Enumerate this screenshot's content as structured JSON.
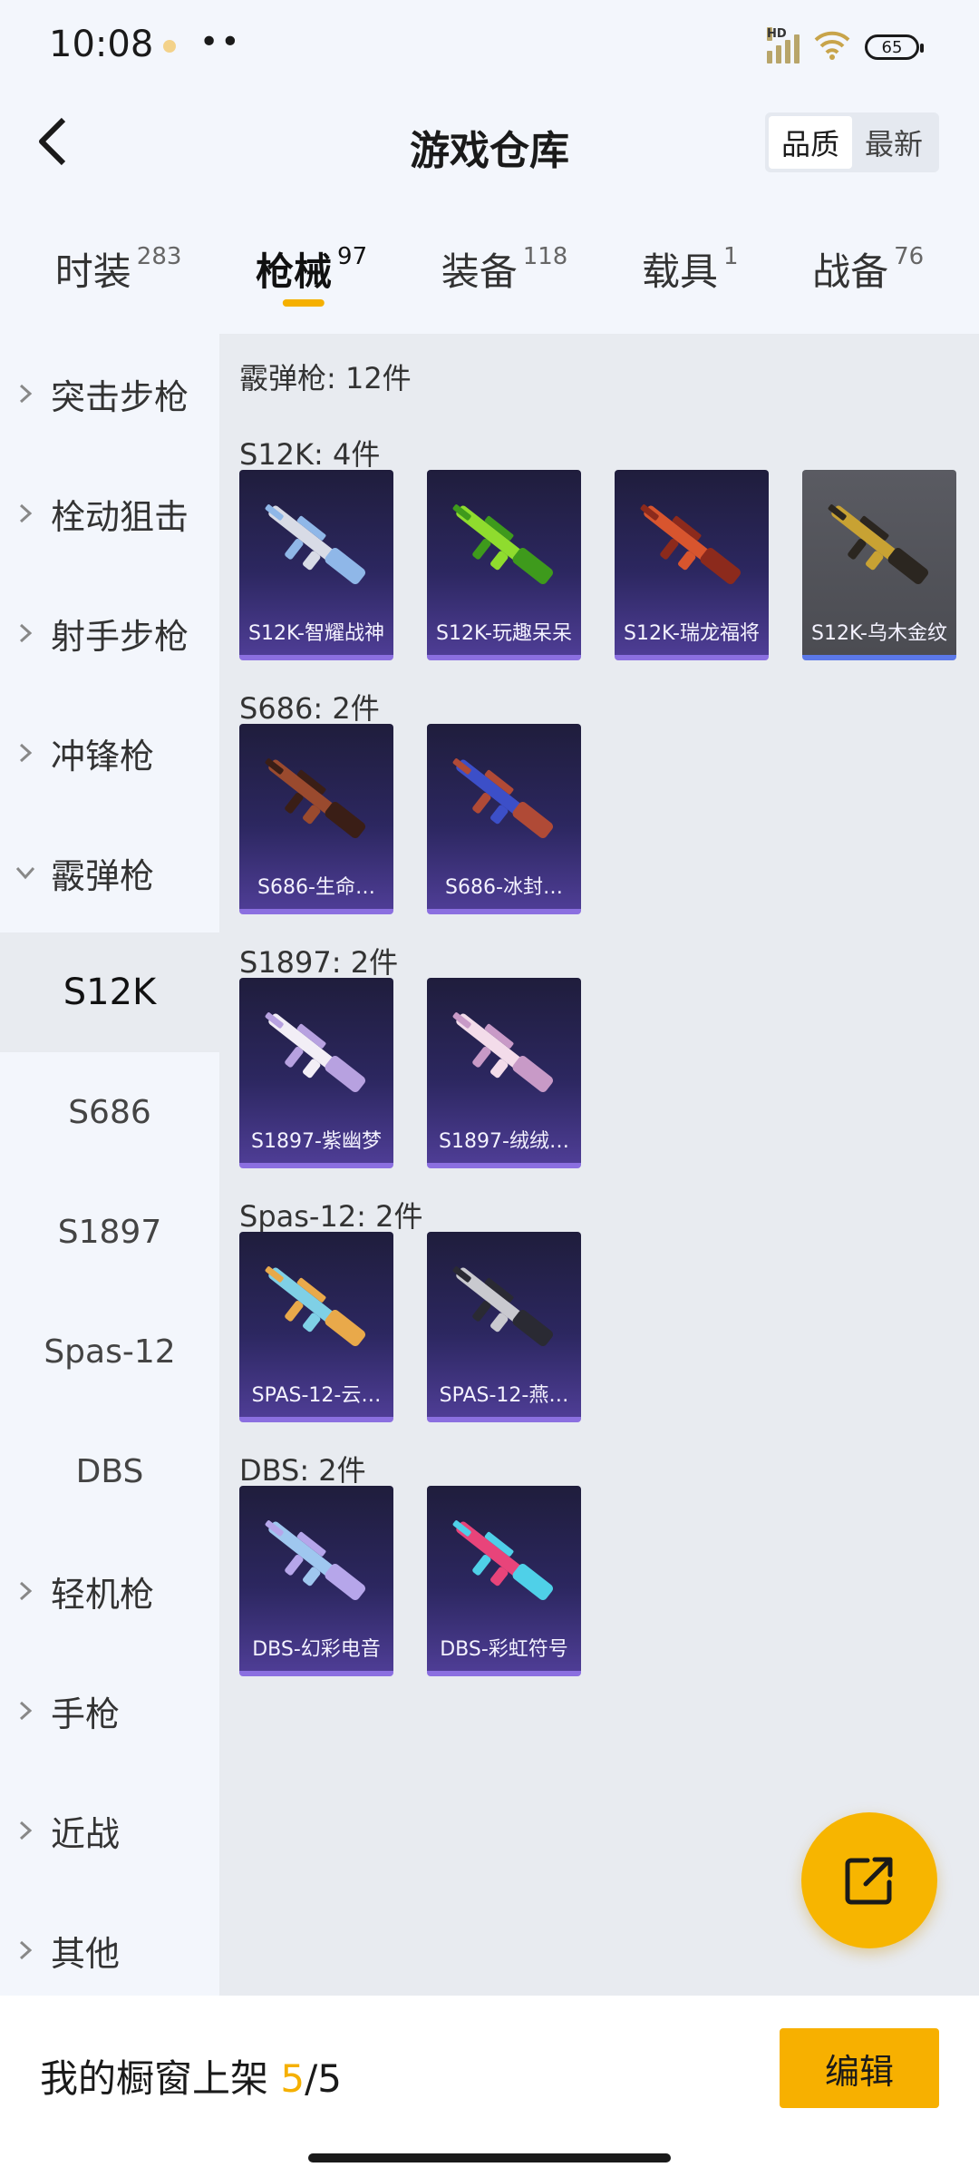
{
  "status_bar": {
    "time": "10:08",
    "hd": "HD",
    "wifi_sub": "6",
    "battery": "65"
  },
  "nav": {
    "title": "游戏仓库",
    "sort": [
      "品质",
      "最新"
    ],
    "sort_active": 0
  },
  "tabs": [
    {
      "label": "时装",
      "count": "283"
    },
    {
      "label": "枪械",
      "count": "97"
    },
    {
      "label": "装备",
      "count": "118"
    },
    {
      "label": "载具",
      "count": "1"
    },
    {
      "label": "战备",
      "count": "76"
    }
  ],
  "active_tab": 1,
  "sidebar": {
    "items_top": [
      "突击步枪",
      "栓动狙击",
      "射手步枪",
      "冲锋枪"
    ],
    "expanded": "霰弹枪",
    "subitems": [
      "S12K",
      "S686",
      "S1897",
      "Spas-12",
      "DBS"
    ],
    "active_sub": 0,
    "items_bottom": [
      "轻机枪",
      "手枪",
      "近战",
      "其他"
    ]
  },
  "content": {
    "total": "霰弹枪: 12件",
    "groups": [
      {
        "title": "S12K: 4件",
        "items": [
          {
            "name": "S12K-智耀战神",
            "colors": [
              "#d8dbe6",
              "#8fb7e8"
            ],
            "gray": false
          },
          {
            "name": "S12K-玩趣呆呆",
            "colors": [
              "#8fdc2e",
              "#3e9a1c"
            ],
            "gray": false
          },
          {
            "name": "S12K-瑞龙福将",
            "colors": [
              "#d8552e",
              "#8c2a1c"
            ],
            "gray": false
          },
          {
            "name": "S12K-乌木金纹",
            "colors": [
              "#c8a233",
              "#2b2620"
            ],
            "gray": true
          }
        ]
      },
      {
        "title": "S686: 2件",
        "items": [
          {
            "name": "S686-生命…",
            "colors": [
              "#9a4a2e",
              "#3a1e16"
            ],
            "gray": false
          },
          {
            "name": "S686-冰封…",
            "colors": [
              "#3c4fc8",
              "#b04a36"
            ],
            "gray": false
          }
        ]
      },
      {
        "title": "S1897: 2件",
        "items": [
          {
            "name": "S1897-紫幽梦",
            "colors": [
              "#f2eef6",
              "#b7a1e0"
            ],
            "gray": false
          },
          {
            "name": "S1897-绒绒…",
            "colors": [
              "#f3dcea",
              "#c89ac7"
            ],
            "gray": false
          }
        ]
      },
      {
        "title": "Spas-12: 2件",
        "items": [
          {
            "name": "SPAS-12-云…",
            "colors": [
              "#7fd0e6",
              "#e9a94a"
            ],
            "gray": false
          },
          {
            "name": "SPAS-12-燕…",
            "colors": [
              "#c9c9cf",
              "#2a2a33"
            ],
            "gray": false
          }
        ]
      },
      {
        "title": "DBS: 2件",
        "items": [
          {
            "name": "DBS-幻彩电音",
            "colors": [
              "#9fc7ef",
              "#b6a6ea"
            ],
            "gray": false
          },
          {
            "name": "DBS-彩虹符号",
            "colors": [
              "#e8447a",
              "#4fd0e8"
            ],
            "gray": false
          }
        ]
      }
    ]
  },
  "bottom": {
    "label": "我的橱窗上架 ",
    "current": "5",
    "sep": "/",
    "total": "5",
    "edit": "编辑"
  },
  "colors": {
    "accent": "#f5b000",
    "card_border": "#8b6fe0"
  }
}
